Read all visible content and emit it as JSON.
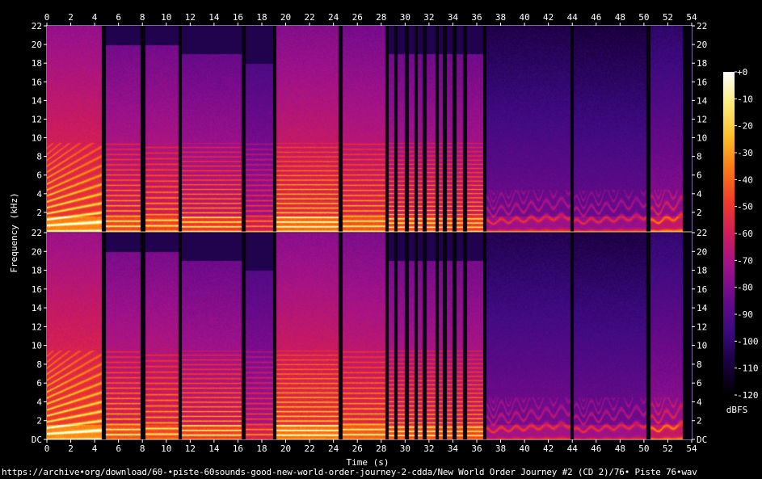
{
  "chart_data": {
    "type": "heatmap",
    "title": "",
    "xlabel": "Time (s)",
    "ylabel": "Frequency (kHz)",
    "xlim": [
      0,
      54
    ],
    "ylim_khz": [
      0,
      22
    ],
    "x_ticks": [
      "0",
      "2",
      "4",
      "6",
      "8",
      "10",
      "12",
      "14",
      "16",
      "18",
      "20",
      "22",
      "24",
      "26",
      "28",
      "30",
      "32",
      "34",
      "36",
      "38",
      "40",
      "42",
      "44",
      "46",
      "48",
      "50",
      "52",
      "54"
    ],
    "y_ticks_channel_top": [
      "2",
      "4",
      "6",
      "8",
      "10",
      "12",
      "14",
      "16",
      "18",
      "20",
      "22"
    ],
    "y_ticks_channel_bottom": [
      "DC",
      "2",
      "4",
      "6",
      "8",
      "10",
      "12",
      "14",
      "16",
      "18",
      "20",
      "22"
    ],
    "channels": 2,
    "colorbar": {
      "label": "dBFS",
      "ticks": [
        "+0",
        "-10",
        "-20",
        "-30",
        "-40",
        "-50",
        "-60",
        "-70",
        "-80",
        "-90",
        "-100",
        "-110",
        "-120"
      ],
      "range_db": [
        -120,
        0
      ],
      "colors": [
        "#000000",
        "#1a0040",
        "#3c0a80",
        "#6a0a8a",
        "#a0128a",
        "#d01c5a",
        "#f03c2a",
        "#fb7a14",
        "#fdbe28",
        "#fdec7a",
        "#ffffff"
      ]
    },
    "segments": [
      {
        "start": 0.0,
        "end": 4.6,
        "cutoff_khz": 22,
        "base_db": -48,
        "harm_khz": 0.75,
        "sweep": 1,
        "hot": 1.0
      },
      {
        "start": 4.9,
        "end": 7.8,
        "cutoff_khz": 20,
        "base_db": -58,
        "harm_khz": 0.55,
        "sweep": 0,
        "hot": 0.9
      },
      {
        "start": 8.2,
        "end": 11.0,
        "cutoff_khz": 20,
        "base_db": -58,
        "harm_khz": 0.6,
        "sweep": 0,
        "hot": 0.85
      },
      {
        "start": 11.3,
        "end": 16.3,
        "cutoff_khz": 19,
        "base_db": -62,
        "harm_khz": 0.5,
        "sweep": 0,
        "hot": 0.95
      },
      {
        "start": 16.6,
        "end": 18.9,
        "cutoff_khz": 18,
        "base_db": -70,
        "harm_khz": 0.55,
        "sweep": 0,
        "hot": 0.7
      },
      {
        "start": 19.2,
        "end": 24.4,
        "cutoff_khz": 22,
        "base_db": -52,
        "harm_khz": 0.5,
        "sweep": 0,
        "hot": 0.95
      },
      {
        "start": 24.7,
        "end": 28.3,
        "cutoff_khz": 22,
        "base_db": -55,
        "harm_khz": 0.55,
        "sweep": 0,
        "hot": 0.85
      },
      {
        "start": 28.6,
        "end": 32.5,
        "cutoff_khz": 19,
        "base_db": -60,
        "harm_khz": 0.45,
        "sweep": 0,
        "hot": 1.0
      },
      {
        "start": 32.8,
        "end": 36.5,
        "cutoff_khz": 19,
        "base_db": -60,
        "harm_khz": 0.45,
        "sweep": 0,
        "hot": 0.9
      },
      {
        "start": 36.8,
        "end": 43.8,
        "cutoff_khz": 22,
        "base_db": -80,
        "harm_khz": 1.2,
        "sweep": 2,
        "hot": 0.6
      },
      {
        "start": 44.1,
        "end": 50.2,
        "cutoff_khz": 22,
        "base_db": -82,
        "harm_khz": 1.3,
        "sweep": 2,
        "hot": 0.6
      },
      {
        "start": 50.5,
        "end": 53.2,
        "cutoff_khz": 22,
        "base_db": -74,
        "harm_khz": 1.1,
        "sweep": 2,
        "hot": 0.75
      }
    ],
    "silent_gaps_s": [
      29.2,
      30.1,
      30.9,
      31.6,
      33.3,
      34.1,
      35.0
    ]
  },
  "footer": {
    "source_path": "https://archive•org/download/60-•piste-60sounds-good-new-world-order-journey-2-cdda/New World Order Journey #2 (CD 2)/76• Piste 76•wav"
  }
}
